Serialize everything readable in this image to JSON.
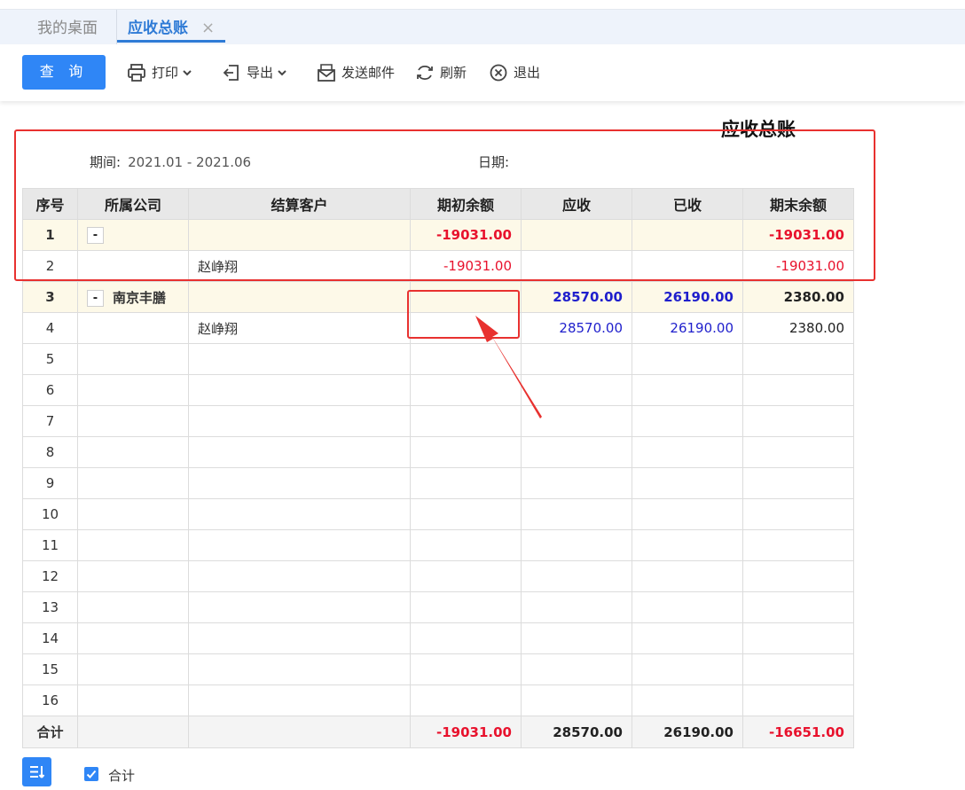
{
  "tabs": {
    "home_label": "我的桌面",
    "active_label": "应收总账",
    "close_glyph": "×"
  },
  "toolbar": {
    "query_label": "查 询",
    "print_label": "打印",
    "export_label": "导出",
    "email_label": "发送邮件",
    "refresh_label": "刷新",
    "exit_label": "退出"
  },
  "report": {
    "title": "应收总账",
    "period_label": "期间:",
    "period_value": "2021.01 - 2021.06",
    "date_label": "日期:"
  },
  "table": {
    "headers": [
      "序号",
      "所属公司",
      "结算客户",
      "期初余额",
      "应收",
      "已收",
      "期末余额"
    ],
    "rows": [
      {
        "idx": "1",
        "company": "",
        "customer": "",
        "opening": "-19031.00",
        "receivable": "",
        "received": "",
        "closing": "-19031.00"
      },
      {
        "idx": "2",
        "company": "",
        "customer": "赵峥翔",
        "opening": "-19031.00",
        "receivable": "",
        "received": "",
        "closing": "-19031.00"
      },
      {
        "idx": "3",
        "company": "南京丰膳",
        "customer": "",
        "opening": "",
        "receivable": "28570.00",
        "received": "26190.00",
        "closing": "2380.00"
      },
      {
        "idx": "4",
        "company": "",
        "customer": "赵峥翔",
        "opening": "",
        "receivable": "28570.00",
        "received": "26190.00",
        "closing": "2380.00"
      }
    ],
    "empty_rows": [
      "5",
      "6",
      "7",
      "8",
      "9",
      "10",
      "11",
      "12",
      "13",
      "14",
      "15",
      "16"
    ],
    "collapse_glyph": "-",
    "total": {
      "label": "合计",
      "opening": "-19031.00",
      "receivable": "28570.00",
      "received": "26190.00",
      "closing": "-16651.00"
    }
  },
  "footer": {
    "checkbox_label": "合计",
    "checkbox_checked": true
  },
  "colors": {
    "accent": "#2f86f6",
    "negative": "#e8122d",
    "blue_value": "#1f1fcc",
    "annotation": "#e8312f"
  }
}
